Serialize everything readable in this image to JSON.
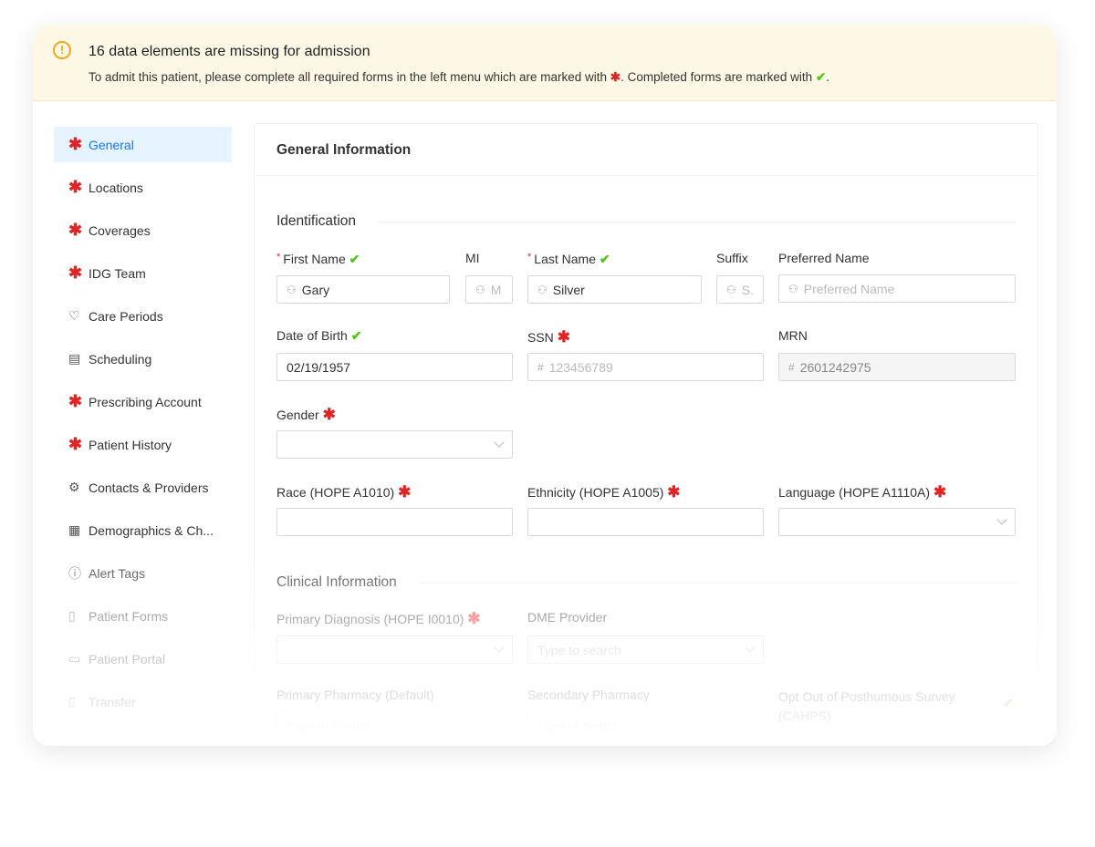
{
  "banner": {
    "title": "16 data elements are missing for admission",
    "desc_part1": "To admit this patient, please complete all required forms in the left menu which are marked with",
    "desc_part2": ". Completed forms are marked with",
    "desc_part3": ".",
    "required_marker": "✱",
    "completed_marker": "✔"
  },
  "sidebar": {
    "items": [
      {
        "label": "General",
        "icon": "required-asterisk-icon",
        "glyph": "✱"
      },
      {
        "label": "Locations",
        "icon": "required-asterisk-icon",
        "glyph": "✱"
      },
      {
        "label": "Coverages",
        "icon": "required-asterisk-icon",
        "glyph": "✱"
      },
      {
        "label": "IDG Team",
        "icon": "required-asterisk-icon",
        "glyph": "✱"
      },
      {
        "label": "Care Periods",
        "icon": "heart-icon",
        "glyph": "♡"
      },
      {
        "label": "Scheduling",
        "icon": "calendar-icon",
        "glyph": "▤"
      },
      {
        "label": "Prescribing Account",
        "icon": "required-asterisk-icon",
        "glyph": "✱"
      },
      {
        "label": "Patient History",
        "icon": "required-asterisk-icon",
        "glyph": "✱"
      },
      {
        "label": "Contacts & Providers",
        "icon": "gear-icon",
        "glyph": "⚙"
      },
      {
        "label": "Demographics & Ch...",
        "icon": "document-icon",
        "glyph": "▦"
      },
      {
        "label": "Alert Tags",
        "icon": "alert-circle-icon",
        "glyph": "ⓘ"
      },
      {
        "label": "Patient Forms",
        "icon": "file-icon",
        "glyph": "▯"
      },
      {
        "label": "Patient Portal",
        "icon": "portal-icon",
        "glyph": "▭"
      },
      {
        "label": "Transfer",
        "icon": "transfer-icon",
        "glyph": "▯"
      }
    ]
  },
  "panel": {
    "title": "General Information",
    "sections": {
      "identification": "Identification",
      "clinical": "Clinical Information"
    },
    "fields": {
      "first_name": {
        "label": "First Name",
        "value": "Gary"
      },
      "mi": {
        "label": "MI",
        "placeholder": "M"
      },
      "last_name": {
        "label": "Last Name",
        "value": "Silver"
      },
      "suffix": {
        "label": "Suffix",
        "placeholder": "S."
      },
      "preferred_name": {
        "label": "Preferred Name",
        "placeholder": "Preferred Name"
      },
      "dob": {
        "label": "Date of Birth",
        "value": "02/19/1957"
      },
      "ssn": {
        "label": "SSN",
        "placeholder": "123456789"
      },
      "mrn": {
        "label": "MRN",
        "value": "2601242975"
      },
      "gender": {
        "label": "Gender",
        "value": ""
      },
      "race": {
        "label": "Race (HOPE A1010)",
        "value": ""
      },
      "ethnicity": {
        "label": "Ethnicity (HOPE A1005)",
        "value": ""
      },
      "language": {
        "label": "Language (HOPE A1110A)",
        "value": ""
      },
      "primary_diagnosis": {
        "label": "Primary Diagnosis (HOPE I0010)",
        "value": ""
      },
      "dme_provider": {
        "label": "DME Provider",
        "placeholder": "Type to search"
      },
      "primary_pharmacy": {
        "label": "Primary Pharmacy (Default)",
        "placeholder": "Type to search"
      },
      "secondary_pharmacy": {
        "label": "Secondary Pharmacy",
        "placeholder": "Type to search"
      },
      "opt_out": {
        "label_line1": "Opt Out of Posthumous Survey",
        "label_line2": "(CAHPS)"
      }
    }
  },
  "colors": {
    "required": "#e02424",
    "completed": "#52c41a",
    "accent": "#1677ff",
    "warning": "#f0a81c",
    "banner_bg": "#fdf8e6"
  }
}
